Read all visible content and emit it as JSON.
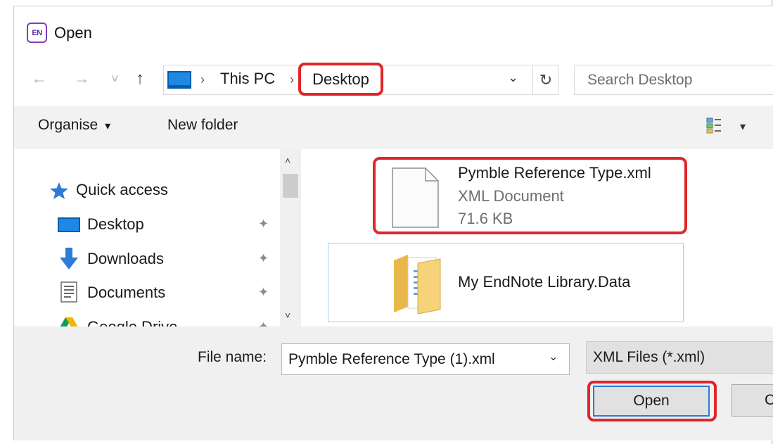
{
  "window": {
    "title": "Open",
    "app_icon_text": "EN"
  },
  "nav": {
    "back_icon": "←",
    "forward_icon": "→",
    "recent_icon": "˅",
    "up_icon": "↑"
  },
  "address": {
    "crumbs": [
      "This PC",
      "Desktop"
    ],
    "separator": "›",
    "dropdown_icon": "⌄",
    "refresh_icon": "↻"
  },
  "search": {
    "placeholder": "Search Desktop"
  },
  "toolbar": {
    "organise_label": "Organise",
    "organise_caret": "▾",
    "new_folder_label": "New folder",
    "view_caret": "▾"
  },
  "sidebar": {
    "items": [
      {
        "label": "Quick access",
        "icon": "star-icon",
        "pinned": false
      },
      {
        "label": "Desktop",
        "icon": "desktop-icon",
        "pinned": true
      },
      {
        "label": "Downloads",
        "icon": "download-icon",
        "pinned": true
      },
      {
        "label": "Documents",
        "icon": "documents-icon",
        "pinned": true
      },
      {
        "label": "Google Drive",
        "icon": "google-drive-icon",
        "pinned": true
      }
    ],
    "pin_glyph": "📌",
    "scroll_up": "˄",
    "scroll_down": "˅"
  },
  "files": [
    {
      "name": "Pymble Reference Type.xml",
      "type": "XML Document",
      "size": "71.6 KB",
      "icon": "document-icon",
      "highlighted": true
    },
    {
      "name": "My EndNote Library.Data",
      "icon": "folder-icon",
      "selected": true
    }
  ],
  "bottom": {
    "filename_label": "File name:",
    "filename_value": "Pymble Reference Type (1).xml",
    "filename_caret": "⌄",
    "filetype_value": "XML Files  (*.xml)",
    "open_label": "Open",
    "cancel_label": "Cancel"
  },
  "colors": {
    "highlight_red": "#e0262b",
    "accent_blue": "#1e88e5",
    "selection_border": "#99d1ff",
    "toolbar_bg": "#f2f2f2"
  }
}
